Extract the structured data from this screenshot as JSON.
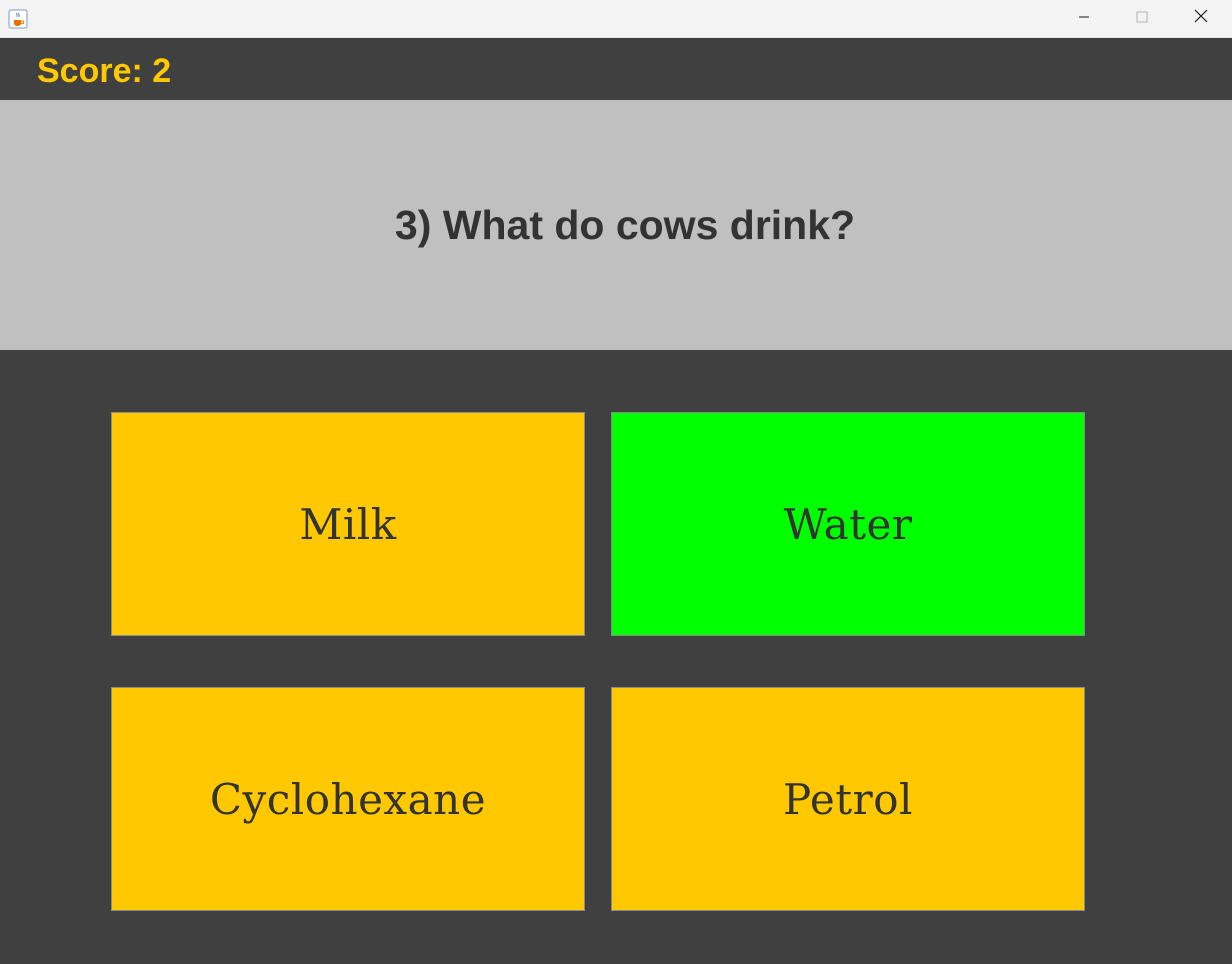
{
  "window": {
    "icon": "java-cup-icon",
    "controls": [
      "minimize-icon",
      "maximize-icon",
      "close-icon"
    ]
  },
  "score": {
    "label": "Score: 2"
  },
  "question": {
    "text": "3) What do cows drink?"
  },
  "answers": [
    {
      "label": "Milk",
      "color": "#ffc800"
    },
    {
      "label": "Water",
      "color": "#00ff00"
    },
    {
      "label": "Cyclohexane",
      "color": "#ffc800"
    },
    {
      "label": "Petrol",
      "color": "#ffc800"
    }
  ],
  "colors": {
    "background": "#404040",
    "question_panel": "#c0c0c0",
    "score_text": "#ffc800",
    "default_answer": "#ffc800",
    "correct_answer": "#00ff00",
    "text_dark": "#333333"
  }
}
